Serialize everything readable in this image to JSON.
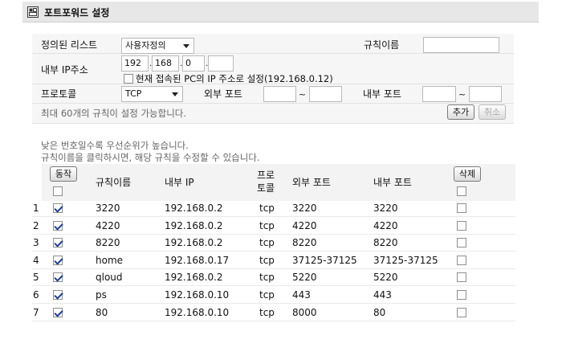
{
  "title": "포트포워드 설정",
  "form": {
    "preset_label": "정의된 리스트",
    "preset_value": "사용자정의",
    "rule_name_label": "규칙이름",
    "rule_name_value": "",
    "internal_ip_label": "내부 IP주소",
    "ip_octets": [
      "192",
      "168",
      "0",
      ""
    ],
    "current_pc_ip_label": "현재 접속된 PC의 IP 주소로 설정(192.168.0.12)",
    "protocol_label": "프로토콜",
    "protocol_value": "TCP",
    "external_port_label": "외부 포트",
    "internal_port_label": "내부 포트",
    "range_sep": "~",
    "max_rules_note": "최대 60개의 규칙이 설정 가능합니다.",
    "add_button": "추가",
    "cancel_button": "취소"
  },
  "notes": {
    "priority": "낮은 번호일수록 우선순위가 높습니다.",
    "edit_hint": "규칙이름을 클릭하시면, 해당 규칙을 수정할 수 있습니다."
  },
  "table": {
    "action_button": "동작",
    "delete_button": "삭제",
    "headers": {
      "rule_name": "규칙이름",
      "internal_ip": "내부 IP",
      "protocol_line1": "프로",
      "protocol_line2": "토콜",
      "external_port": "외부 포트",
      "internal_port": "내부 포트"
    },
    "rows": [
      {
        "num": "1",
        "enabled": true,
        "name": "3220",
        "ip": "192.168.0.2",
        "proto": "tcp",
        "ext": "3220",
        "int": "3220"
      },
      {
        "num": "2",
        "enabled": true,
        "name": "4220",
        "ip": "192.168.0.2",
        "proto": "tcp",
        "ext": "4220",
        "int": "4220"
      },
      {
        "num": "3",
        "enabled": true,
        "name": "8220",
        "ip": "192.168.0.2",
        "proto": "tcp",
        "ext": "8220",
        "int": "8220"
      },
      {
        "num": "4",
        "enabled": true,
        "name": "home",
        "ip": "192.168.0.17",
        "proto": "tcp",
        "ext": "37125-37125",
        "int": "37125-37125"
      },
      {
        "num": "5",
        "enabled": true,
        "name": "qloud",
        "ip": "192.168.0.2",
        "proto": "tcp",
        "ext": "5220",
        "int": "5220"
      },
      {
        "num": "6",
        "enabled": true,
        "name": "ps",
        "ip": "192.168.0.10",
        "proto": "tcp",
        "ext": "443",
        "int": "443"
      },
      {
        "num": "7",
        "enabled": true,
        "name": "80",
        "ip": "192.168.0.10",
        "proto": "tcp",
        "ext": "8000",
        "int": "80"
      }
    ]
  }
}
